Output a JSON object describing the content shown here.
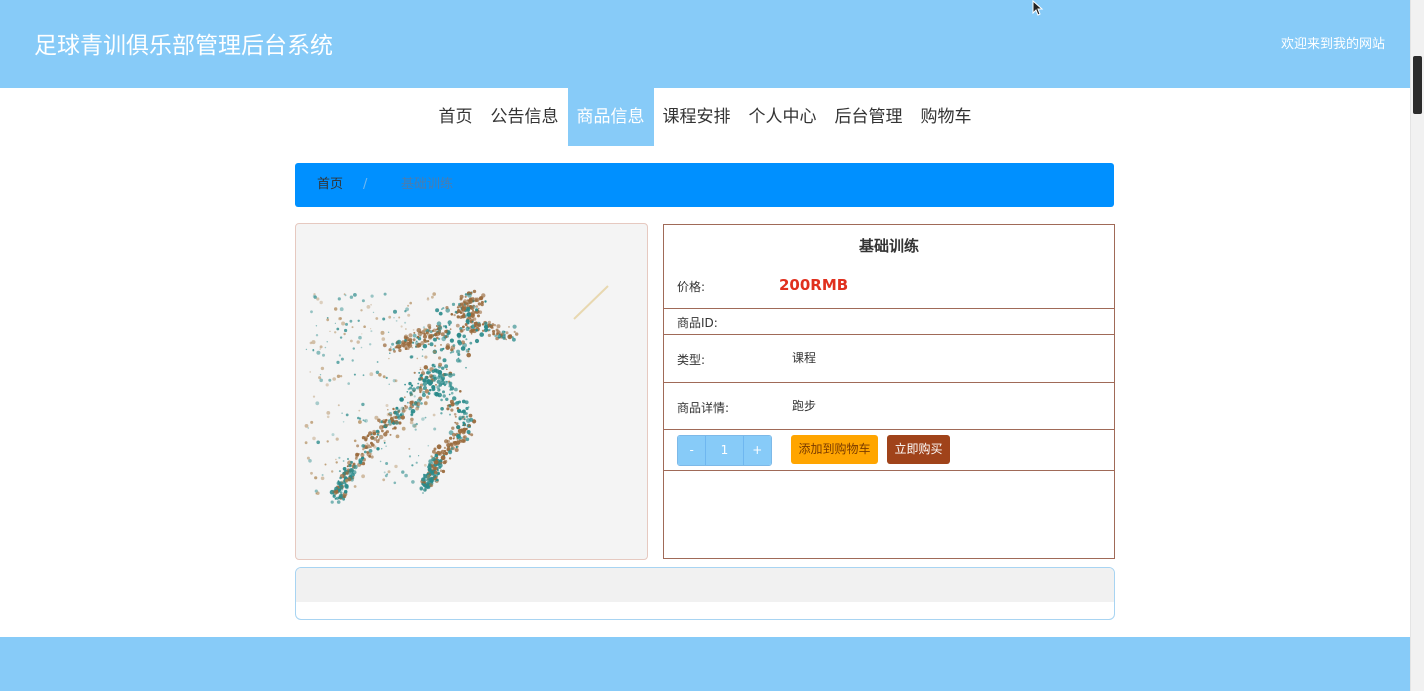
{
  "header": {
    "site_title": "足球青训俱乐部管理后台系统",
    "welcome": "欢迎来到我的网站"
  },
  "nav": {
    "items": [
      "首页",
      "公告信息",
      "商品信息",
      "课程安排",
      "个人中心",
      "后台管理",
      "购物车"
    ],
    "active": "商品信息"
  },
  "breadcrumb": {
    "home": "首页",
    "separator": "/",
    "current": "基础训练"
  },
  "product": {
    "title": "基础训练",
    "price_label": "价格:",
    "price": "200RMB",
    "id_label": "商品ID:",
    "id_value": "",
    "type_label": "类型:",
    "type_value": "课程",
    "detail_label": "商品详情:",
    "detail_value": "跑步"
  },
  "purchase": {
    "minus": "-",
    "quantity": "1",
    "plus": "+",
    "add_to_cart": "添加到购物车",
    "buy_now": "立即购买"
  },
  "colors": {
    "header_bg": "#87cbf8",
    "breadcrumb_bg": "#0090ff",
    "price": "#e0301e",
    "cart_button": "#ffa500",
    "buy_button": "#a0431a",
    "detail_border": "#a06a58"
  },
  "image": {
    "subject": "particle-runner-illustration"
  }
}
